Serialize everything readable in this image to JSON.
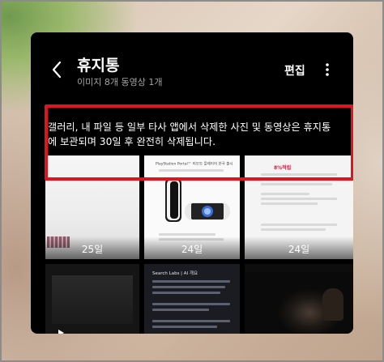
{
  "header": {
    "title": "휴지통",
    "subtitle": "이미지 8개 동영상 1개",
    "edit_label": "편집",
    "back_icon": "chevron-left-icon",
    "more_icon": "more-vertical-icon"
  },
  "notice": {
    "text": "갤러리, 내 파일 등 일부 타사 앱에서 삭제한 사진 및 동영상은 휴지통에 보관되며 30일 후 완전히 삭제됩니다."
  },
  "grid": {
    "items": [
      {
        "days_left": "25일"
      },
      {
        "days_left": "24일"
      },
      {
        "days_left": "24일"
      }
    ],
    "thumb2_heading": "PlayStation Portal™ 리모트 플레이어 한국 출시",
    "thumb3_badge": "8%적립",
    "thumb5_header": "Search Labs | AI 개요"
  },
  "colors": {
    "highlight": "#e0141e",
    "background": "#000000",
    "text": "#ffffff",
    "subtext": "#a6a6a6"
  }
}
